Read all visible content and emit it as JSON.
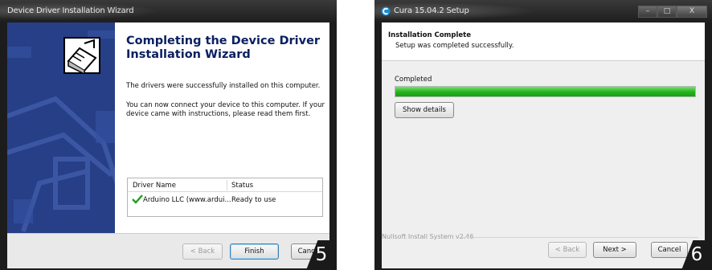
{
  "driver_wizard": {
    "title": "Device Driver Installation Wizard",
    "heading": "Completing the Device Driver Installation Wizard",
    "text_success": "The drivers were successfully installed on this computer.",
    "text_connect": "You can now connect your device to this computer. If your device came with instructions, please read them first.",
    "table": {
      "columns": [
        "Driver Name",
        "Status"
      ],
      "rows": [
        {
          "name": "Arduino LLC (www.ardui...",
          "status": "Ready to use"
        }
      ]
    },
    "buttons": {
      "back": "< Back",
      "finish": "Finish",
      "cancel": "Cancel"
    },
    "step_badge": "5"
  },
  "cura_setup": {
    "title": "Cura 15.04.2 Setup",
    "header_title": "Installation Complete",
    "header_subtitle": "Setup was completed successfully.",
    "status_label": "Completed",
    "progress": 1.0,
    "show_details": "Show details",
    "branding": "Nullsoft Install System v2.46",
    "buttons": {
      "back": "< Back",
      "next": "Next >",
      "cancel": "Cancel"
    },
    "step_badge": "6"
  },
  "colors": {
    "banner_blue": "#273f86",
    "heading_navy": "#0a1f61",
    "progress_green": "#23b21b",
    "check_green": "#1f9e1f"
  }
}
